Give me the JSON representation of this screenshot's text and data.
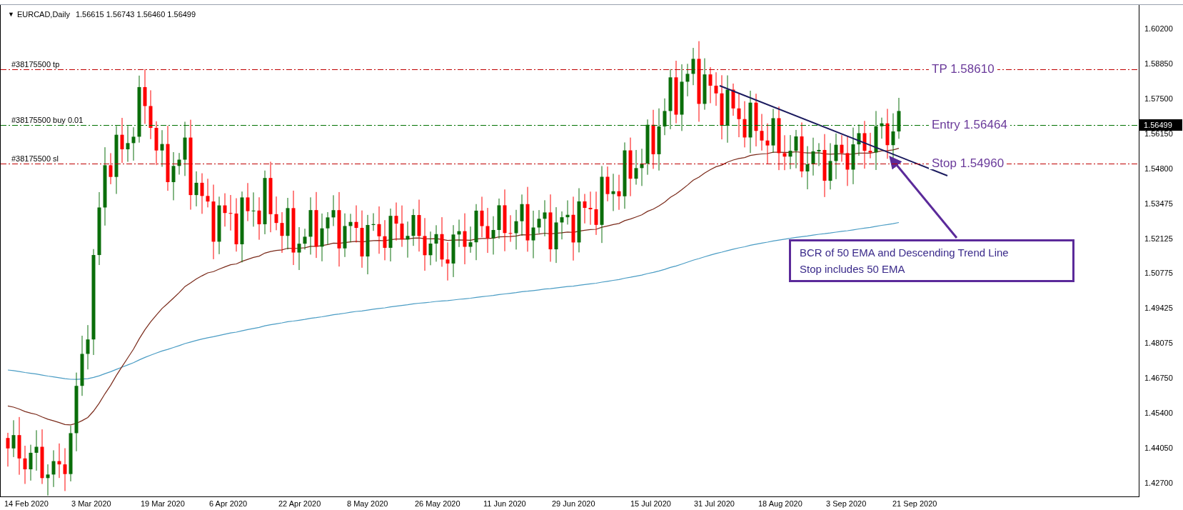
{
  "chart": {
    "header": {
      "toggle": "▼",
      "symbol": "EURCAD,Daily",
      "ohlc": "1.56615 1.56743 1.56460 1.56499"
    },
    "order_lines": [
      {
        "kind": "tp",
        "label": "#38175500 tp",
        "color": "#c00000"
      },
      {
        "kind": "entry",
        "label": "#38175500 buy 0.01",
        "color": "#007000"
      },
      {
        "kind": "sl",
        "label": "#38175500 sl",
        "color": "#c00000"
      }
    ],
    "annotations": [
      {
        "kind": "tp",
        "text": "TP 1.58610"
      },
      {
        "kind": "entry",
        "text": "Entry 1.56464"
      },
      {
        "kind": "sl",
        "text": "Stop 1.54960"
      }
    ],
    "callout": [
      "BCR of 50 EMA and Descending Trend Line",
      "Stop includes 50 EMA"
    ],
    "price_axis": [
      "1.60200",
      "1.58850",
      "1.57500",
      "1.56150",
      "1.54800",
      "1.53475",
      "1.52125",
      "1.50775",
      "1.49425",
      "1.48075",
      "1.46750",
      "1.45400",
      "1.44050",
      "1.42700"
    ],
    "current_price": "1.56499",
    "date_axis": [
      "14 Feb 2020",
      "3 Mar 2020",
      "19 Mar 2020",
      "6 Apr 2020",
      "22 Apr 2020",
      "8 May 2020",
      "26 May 2020",
      "11 Jun 2020",
      "29 Jun 2020",
      "15 Jul 2020",
      "31 Jul 2020",
      "18 Aug 2020",
      "3 Sep 2020",
      "21 Sep 2020"
    ]
  }
}
